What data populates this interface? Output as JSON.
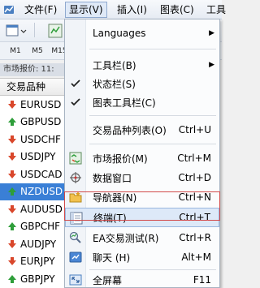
{
  "menubar": {
    "items": [
      "文件(F)",
      "显示(V)",
      "插入(I)",
      "图表(C)",
      "工具"
    ],
    "active_index": 1
  },
  "toolbar": {
    "timeframes": [
      "M1",
      "M5",
      "M15"
    ]
  },
  "market_watch": {
    "title": "市场报价: 11:",
    "column_header": "交易品种",
    "selected_index": 5,
    "symbols": [
      {
        "name": "EURUSD",
        "direction": "down"
      },
      {
        "name": "GBPUSD",
        "direction": "up"
      },
      {
        "name": "USDCHF",
        "direction": "down"
      },
      {
        "name": "USDJPY",
        "direction": "down"
      },
      {
        "name": "USDCAD",
        "direction": "down"
      },
      {
        "name": "NZDUSD",
        "direction": "up"
      },
      {
        "name": "AUDUSD",
        "direction": "down"
      },
      {
        "name": "GBPCHF",
        "direction": "up"
      },
      {
        "name": "AUDJPY",
        "direction": "down"
      },
      {
        "name": "EURJPY",
        "direction": "down"
      },
      {
        "name": "GBPJPY",
        "direction": "up"
      }
    ]
  },
  "view_menu": {
    "languages": "Languages",
    "toolbars": "工具栏(B)",
    "status_bar": "状态栏(S)",
    "chart_toolbar": "图表工具栏(C)",
    "symbols": {
      "label": "交易品种列表(O)",
      "shortcut": "Ctrl+U"
    },
    "market_watch": {
      "label": "市场报价(M)",
      "shortcut": "Ctrl+M"
    },
    "data_window": {
      "label": "数据窗口",
      "shortcut": "Ctrl+D"
    },
    "navigator": {
      "label": "导航器(N)",
      "shortcut": "Ctrl+N"
    },
    "terminal": {
      "label": "终端(T)",
      "shortcut": "Ctrl+T"
    },
    "tester": {
      "label": "EA交易测试(R)",
      "shortcut": "Ctrl+R"
    },
    "chat": {
      "label": "聊天 (H)",
      "shortcut": "Alt+M"
    },
    "fullscreen": {
      "label": "全屏幕",
      "shortcut": "F11"
    }
  },
  "colors": {
    "up_arrow": "#2e9e3a",
    "down_arrow": "#d9472b",
    "selection": "#3a7fd6",
    "highlight_box": "#d24a4a"
  }
}
